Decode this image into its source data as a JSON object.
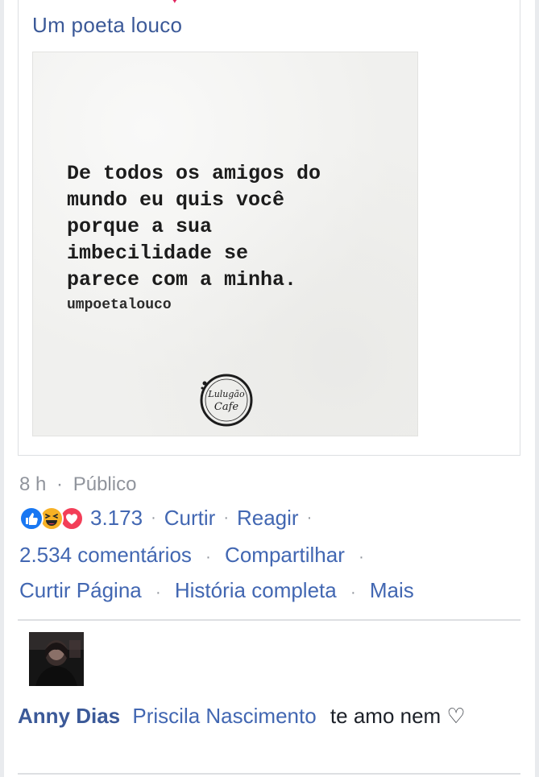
{
  "shared_post": {
    "page_name": "Um poeta louco",
    "image": {
      "quote_lines": "De todos os amigos do\nmundo eu quis você\nporque a sua\nimbecilidade se\nparece com a minha.",
      "author": "umpoetalouco",
      "stamp_text_top": "Lulugão",
      "stamp_text_bottom": "Cafe"
    }
  },
  "post_meta": {
    "time": "8 h",
    "separator": "·",
    "privacy": "Público"
  },
  "reactions": {
    "icons": [
      "like-icon",
      "haha-icon",
      "love-icon"
    ],
    "count": "3.173"
  },
  "actions": {
    "like": "Curtir",
    "react": "Reagir",
    "comments": "2.534 comentários",
    "share": "Compartilhar",
    "like_page": "Curtir Página",
    "full_story": "História completa",
    "more": "Mais"
  },
  "comment": {
    "author": "Anny Dias",
    "mention": "Priscila Nascimento",
    "text": "te amo nem ♡"
  },
  "colors": {
    "link_blue": "#4267b2",
    "name_blue": "#3b5998",
    "meta_gray": "#90949c",
    "like_blue": "#1877f2",
    "love_red": "#f33e58",
    "haha_yellow": "#f7b125"
  }
}
